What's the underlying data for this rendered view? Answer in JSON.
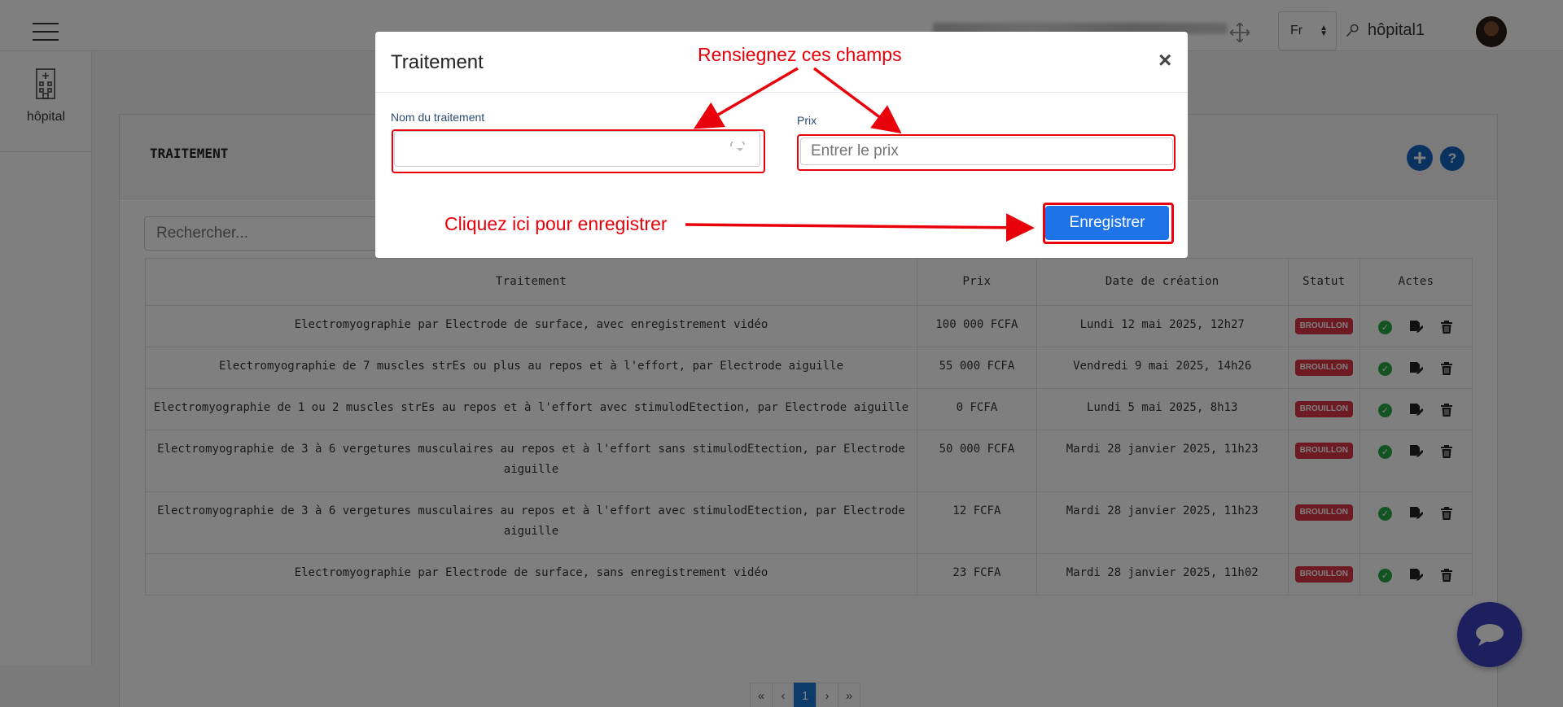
{
  "topbar": {
    "language": "Fr",
    "user_name": "hôpital1"
  },
  "sidebar": {
    "items": [
      {
        "label": "hôpital",
        "icon": "hospital-icon"
      }
    ]
  },
  "page": {
    "title": "TRAITEMENT",
    "search_placeholder": "Rechercher..."
  },
  "table": {
    "columns": [
      "Traitement",
      "Prix",
      "Date de création",
      "Statut",
      "Actes"
    ],
    "rows": [
      {
        "traitement": "Electromyographie par Electrode de surface, avec enregistrement vidéo",
        "prix": "100 000 FCFA",
        "date": "Lundi 12 mai 2025, 12h27",
        "statut": "BROUILLON"
      },
      {
        "traitement": "Electromyographie de 7 muscles strEs ou plus au repos et à l'effort, par Electrode aiguille",
        "prix": "55 000 FCFA",
        "date": "Vendredi 9 mai 2025, 14h26",
        "statut": "BROUILLON"
      },
      {
        "traitement": "Electromyographie de 1 ou 2 muscles strEs au repos et à l'effort avec stimulodEtection, par Electrode aiguille",
        "prix": "0 FCFA",
        "date": "Lundi 5 mai 2025, 8h13",
        "statut": "BROUILLON"
      },
      {
        "traitement": "Electromyographie de 3 à 6 vergetures musculaires au repos et à l'effort sans stimulodEtection, par Electrode aiguille",
        "prix": "50 000 FCFA",
        "date": "Mardi 28 janvier 2025, 11h23",
        "statut": "BROUILLON"
      },
      {
        "traitement": "Electromyographie de 3 à 6 vergetures musculaires au repos et à l'effort avec stimulodEtection, par Electrode aiguille",
        "prix": "12 FCFA",
        "date": "Mardi 28 janvier 2025, 11h23",
        "statut": "BROUILLON"
      },
      {
        "traitement": "Electromyographie par Electrode de surface, sans enregistrement vidéo",
        "prix": "23 FCFA",
        "date": "Mardi 28 janvier 2025, 11h02",
        "statut": "BROUILLON"
      }
    ]
  },
  "pagination": {
    "first": "«",
    "prev": "‹",
    "current": "1",
    "next": "›",
    "last": "»"
  },
  "modal": {
    "title": "Traitement",
    "close": "×",
    "name_label": "Nom du traitement",
    "name_value": "",
    "price_label": "Prix",
    "price_placeholder": "Entrer le prix",
    "save_label": "Enregistrer"
  },
  "annotations": {
    "fields": "Rensiegnez ces champs",
    "save": "Cliquez ici pour enregistrer"
  },
  "colors": {
    "primary": "#1e73e8",
    "annotation_red": "#e8000b",
    "badge_red": "#dc3545",
    "success": "#28a745",
    "chat_fab": "#3b3fbf"
  }
}
